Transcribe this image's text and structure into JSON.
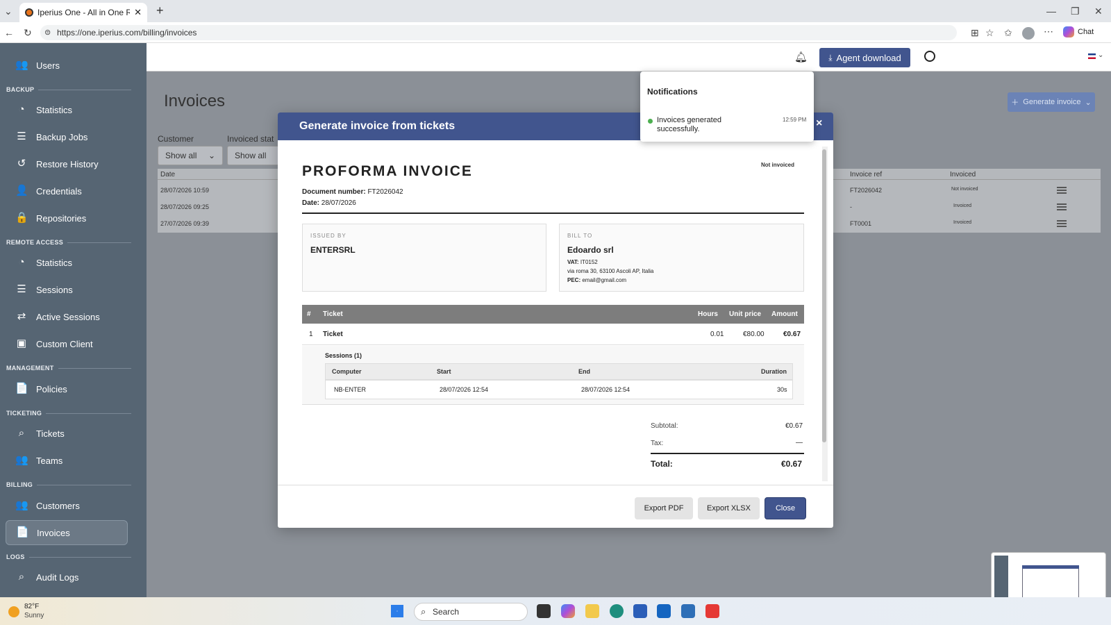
{
  "browser": {
    "tab_title": "Iperius One - All in One RMM Suite",
    "new_tab": "+",
    "url": "https://one.iperius.com/billing/invoices",
    "chat_label": "Chat"
  },
  "sidebar": {
    "users": "Users",
    "sections": {
      "backup": "BACKUP",
      "remote": "REMOTE ACCESS",
      "management": "MANAGEMENT",
      "ticketing": "TICKETING",
      "billing": "BILLING",
      "logs": "LOGS"
    },
    "backup_items": [
      "Statistics",
      "Backup Jobs",
      "Restore History",
      "Credentials",
      "Repositories"
    ],
    "remote_items": [
      "Statistics",
      "Sessions",
      "Active Sessions",
      "Custom Client"
    ],
    "management_items": [
      "Policies"
    ],
    "ticketing_items": [
      "Tickets",
      "Teams"
    ],
    "billing_items": [
      "Customers",
      "Invoices"
    ],
    "logs_items": [
      "Audit Logs"
    ],
    "active_item": "Invoices"
  },
  "topbar": {
    "agent_download": "Agent download"
  },
  "page": {
    "title": "Invoices",
    "generate_button": "Generate invoice",
    "filters": {
      "customer_label": "Customer",
      "customer_value": "Show all",
      "status_label": "Invoiced stat",
      "status_value": "Show all"
    },
    "table": {
      "headers": {
        "date": "Date",
        "invoice_ref": "Invoice ref",
        "invoiced": "Invoiced"
      },
      "rows": [
        {
          "date": "28/07/2026 10:59",
          "ref": "FT2026042",
          "invoiced": "Not invoiced"
        },
        {
          "date": "28/07/2026 09:25",
          "ref": "-",
          "invoiced": "Invoiced"
        },
        {
          "date": "27/07/2026 09:39",
          "ref": "FT0001",
          "invoiced": "Invoiced"
        }
      ]
    }
  },
  "notification": {
    "title": "Notifications",
    "message": "Invoices generated successfully.",
    "time": "12:59 PM",
    "dot_color": "#4caf50"
  },
  "modal": {
    "title": "Generate invoice from tickets",
    "close": "×",
    "invoice": {
      "heading": "PROFORMA INVOICE",
      "status_badge": "Not invoiced",
      "doc_number_label": "Document number:",
      "doc_number": "FT2026042",
      "date_label": "Date:",
      "date": "28/07/2026",
      "issued_by_label": "ISSUED BY",
      "issuer": "ENTERSRL",
      "bill_to_label": "BILL TO",
      "client": "Edoardo srl",
      "vat_label": "VAT:",
      "vat": "IT0152",
      "address": "via roma 30, 63100 Ascoli AP, Italia",
      "pec_label": "PEC:",
      "pec": "email@gmail.com",
      "table_headers": {
        "num": "#",
        "ticket": "Ticket",
        "hours": "Hours",
        "unit_price": "Unit price",
        "amount": "Amount"
      },
      "line": {
        "num": "1",
        "ticket": "Ticket",
        "hours": "0.01",
        "unit_price": "€80.00",
        "amount": "€0.67"
      },
      "sessions_label": "Sessions (1)",
      "session_headers": {
        "computer": "Computer",
        "start": "Start",
        "end": "End",
        "duration": "Duration"
      },
      "session": {
        "computer": "NB-ENTER",
        "start": "28/07/2026 12:54",
        "end": "28/07/2026 12:54",
        "duration": "30s"
      },
      "subtotal_label": "Subtotal:",
      "subtotal": "€0.67",
      "tax_label": "Tax:",
      "tax": "—",
      "total_label": "Total:",
      "total": "€0.67"
    },
    "buttons": {
      "export_pdf": "Export PDF",
      "export_xlsx": "Export XLSX",
      "close": "Close"
    }
  },
  "taskbar": {
    "weather_temp": "82°F",
    "weather_desc": "Sunny",
    "search": "Search"
  }
}
